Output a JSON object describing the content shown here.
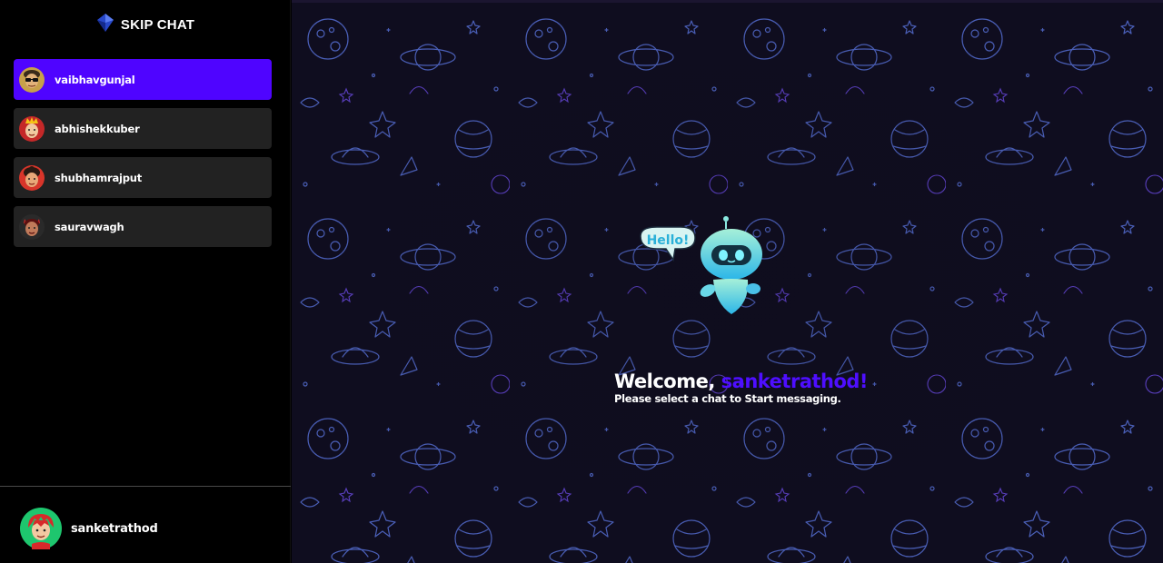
{
  "app": {
    "brand_title": "SKIP CHAT",
    "brand_icon": "diamond-logo-icon"
  },
  "sidebar": {
    "contacts": [
      {
        "username": "vaibhavgunjal",
        "active": true,
        "avatar": "avatar-glasses-icon"
      },
      {
        "username": "abhishekkuber",
        "active": false,
        "avatar": "avatar-crown-icon"
      },
      {
        "username": "shubhamrajput",
        "active": false,
        "avatar": "avatar-hair-icon"
      },
      {
        "username": "sauravwagh",
        "active": false,
        "avatar": "avatar-devil-icon"
      }
    ],
    "current_user": {
      "username": "sanketrathod",
      "avatar": "avatar-red-hair-icon"
    }
  },
  "main": {
    "robot_bubble": "Hello!",
    "welcome_prefix": "Welcome, ",
    "welcome_user": "sanketrathod!",
    "welcome_sub": "Please select a chat to Start messaging."
  },
  "colors": {
    "accent": "#4e0eff",
    "active_contact": "#4f04ff",
    "contact_bg": "#222222",
    "background": "#000000",
    "doodle_line": "#4a5fb8"
  }
}
